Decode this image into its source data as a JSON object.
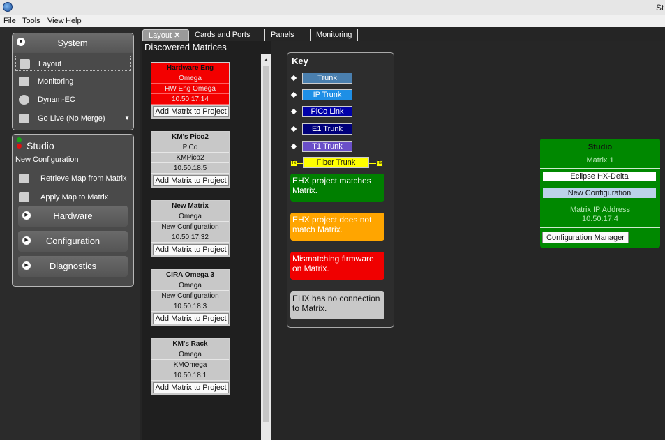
{
  "window": {
    "title": "St"
  },
  "menu": [
    "File",
    "Tools",
    "View",
    "Help"
  ],
  "system": {
    "title": "System",
    "items": [
      "Layout",
      "Monitoring",
      "Dynam-EC",
      "Go Live (No Merge)"
    ]
  },
  "studio_panel": {
    "title": "Studio",
    "subtitle": "New Configuration",
    "items": [
      "Retrieve Map from Matrix",
      "Apply Map to Matrix"
    ],
    "sections": [
      "Hardware",
      "Configuration",
      "Diagnostics"
    ]
  },
  "tabs": {
    "layout": "Layout",
    "close": "✕",
    "cards": "Cards and Ports",
    "panels": "Panels",
    "monitoring": "Monitoring"
  },
  "discovered": {
    "title": "Discovered Matrices",
    "add_label": "Add Matrix to Project",
    "matrices": [
      {
        "name": "Hardware Eng",
        "type": "Omega",
        "config": "HW Eng Omega",
        "ip": "10.50.17.14"
      },
      {
        "name": "KM's Pico2",
        "type": "PiCo",
        "config": "KMPico2",
        "ip": "10.50.18.5"
      },
      {
        "name": "New Matrix",
        "type": "Omega",
        "config": "New Configuration",
        "ip": "10.50.17.32"
      },
      {
        "name": "CIRA Omega 3",
        "type": "Omega",
        "config": "New Configuration",
        "ip": "10.50.18.3"
      },
      {
        "name": "KM's Rack",
        "type": "Omega",
        "config": "KMOmega",
        "ip": "10.50.18.1"
      }
    ]
  },
  "key": {
    "title": "Key",
    "trunks": [
      "Trunk",
      "IP Trunk",
      "PiCo Link",
      "E1 Trunk",
      "T1 Trunk"
    ],
    "fiber": "Fiber Trunk",
    "fiber_tx": "Tx",
    "fiber_rx": "Rx",
    "states": [
      "EHX project matches Matrix.",
      "EHX project does not match Matrix.",
      "Mismatching firmware on Matrix.",
      "EHX has no connection to Matrix."
    ]
  },
  "studio_card": {
    "title": "Studio",
    "matrix": "Matrix 1",
    "model": "Eclipse HX-Delta",
    "config": "New Configuration",
    "ip_label": "Matrix IP Address",
    "ip": "10.50.17.4",
    "button": "Configuration Manager"
  },
  "colors": {
    "trunk": "#4a7fae",
    "ip_trunk": "#1e8fe6",
    "pico": "#0000a8",
    "e1": "#00007a",
    "t1": "#6a4fc8",
    "fiber": "#ffff00",
    "green": "#007f00",
    "orange": "#ffa500",
    "red": "#f00000",
    "grey": "#c8c8c8"
  }
}
